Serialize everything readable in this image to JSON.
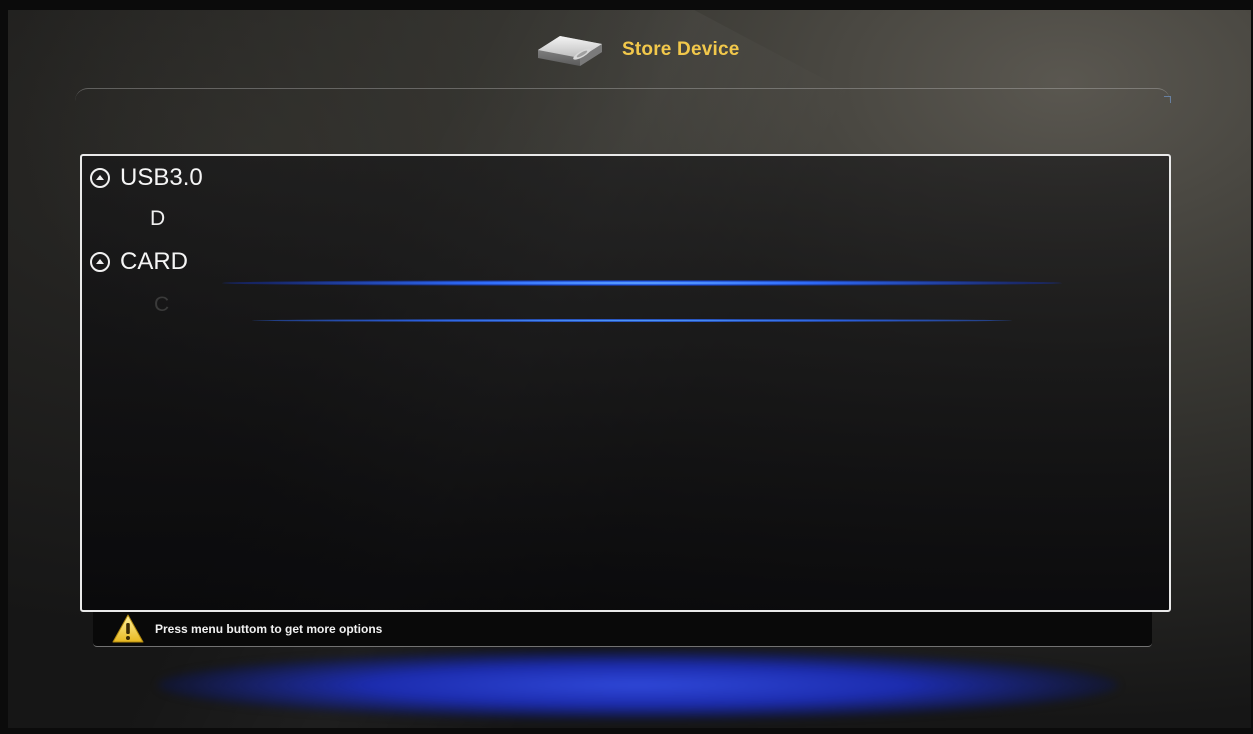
{
  "header": {
    "title": "Store Device",
    "icon": "hard-drive-icon",
    "title_color": "#f2c84b"
  },
  "tree": {
    "groups": [
      {
        "label": "USB3.0",
        "icon": "collapse-icon",
        "children": [
          "D"
        ]
      },
      {
        "label": "CARD",
        "icon": "collapse-icon",
        "children": [
          "C"
        ]
      }
    ]
  },
  "status_bar": {
    "icon": "warning-icon",
    "message": "Press menu buttom to get more options"
  },
  "colors": {
    "accent_blue": "#2e6cff",
    "panel_border": "#e9e9e9",
    "warning_yellow": "#f5d34a"
  }
}
